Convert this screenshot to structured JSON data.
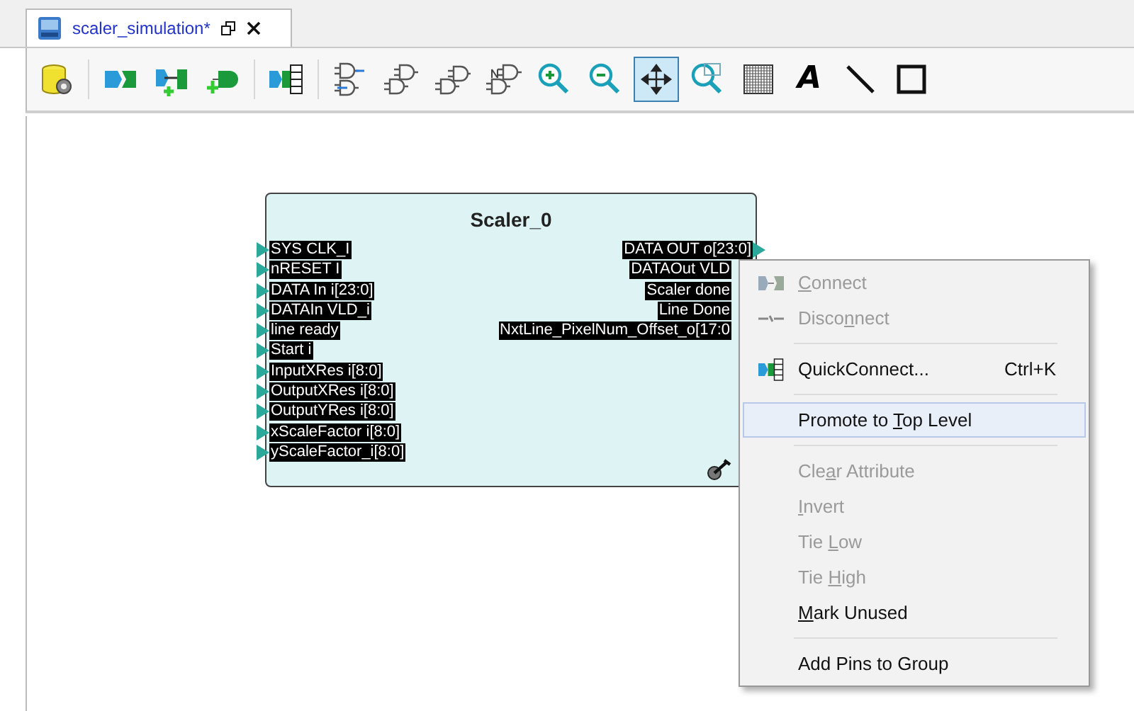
{
  "tab": {
    "title": "scaler_simulation*",
    "selected": true
  },
  "toolbar": [
    {
      "kind": "db-gear",
      "pressed": false
    },
    {
      "kind": "separator"
    },
    {
      "kind": "connect",
      "pressed": false
    },
    {
      "kind": "add-port",
      "pressed": false
    },
    {
      "kind": "add-pin",
      "pressed": false
    },
    {
      "kind": "separator"
    },
    {
      "kind": "quickconnect",
      "pressed": false
    },
    {
      "kind": "separator"
    },
    {
      "kind": "gates-swap",
      "pressed": false
    },
    {
      "kind": "gate-a",
      "pressed": false
    },
    {
      "kind": "gate-b",
      "pressed": false
    },
    {
      "kind": "gate-c",
      "pressed": false
    },
    {
      "kind": "zoom-in",
      "pressed": false
    },
    {
      "kind": "zoom-out",
      "pressed": false
    },
    {
      "kind": "fit",
      "pressed": true
    },
    {
      "kind": "zoom-area",
      "pressed": false
    },
    {
      "kind": "grid",
      "pressed": false
    },
    {
      "kind": "text",
      "label": "A",
      "pressed": false
    },
    {
      "kind": "line",
      "pressed": false
    },
    {
      "kind": "rect",
      "pressed": false
    }
  ],
  "block": {
    "title": "Scaler_0",
    "inputs": [
      "SYS CLK_I",
      "nRESET I",
      "DATA In i[23:0]",
      "DATAIn VLD_i",
      "line ready",
      "Start i",
      "InputXRes i[8:0]",
      "OutputXRes i[8:0]",
      "OutputYRes i[8:0]",
      "xScaleFactor i[8:0]",
      "yScaleFactor_i[8:0]"
    ],
    "outputs": [
      {
        "label": "DATA OUT o[23:0]",
        "pin": true
      },
      {
        "label": "DATAOut VLD",
        "pin": false
      },
      {
        "label": "Scaler done",
        "pin": false
      },
      {
        "label": "Line Done",
        "pin": false
      },
      {
        "label": "NxtLine_PixelNum_Offset_o[17:0",
        "pin": false
      }
    ]
  },
  "context_menu": [
    {
      "kind": "connect",
      "label_key": "C",
      "label_after": "onnect",
      "disabled": true,
      "selected": false
    },
    {
      "kind": "disconnect",
      "label_before": "Disco",
      "label_key": "n",
      "label_after": "nect",
      "disabled": true,
      "selected": false
    },
    {
      "kind": "separator"
    },
    {
      "kind": "quickconnect",
      "label_before": "QuickConnect...",
      "shortcut": "Ctrl+K",
      "disabled": false,
      "selected": false
    },
    {
      "kind": "separator"
    },
    {
      "kind": "item",
      "label_before": "Promote to ",
      "label_key": "T",
      "label_after": "op Level",
      "disabled": false,
      "selected": true
    },
    {
      "kind": "separator"
    },
    {
      "kind": "item",
      "label_before": "Cle",
      "label_key": "a",
      "label_after": "r Attribute",
      "disabled": true,
      "selected": false
    },
    {
      "kind": "item",
      "label_key": "I",
      "label_after": "nvert",
      "disabled": true,
      "selected": false
    },
    {
      "kind": "item",
      "label_before": "Tie ",
      "label_key": "L",
      "label_after": "ow",
      "disabled": true,
      "selected": false
    },
    {
      "kind": "item",
      "label_before": "Tie ",
      "label_key": "H",
      "label_after": "igh",
      "disabled": true,
      "selected": false
    },
    {
      "kind": "item",
      "label_key": "M",
      "label_after": "ark Unused",
      "disabled": false,
      "selected": false
    },
    {
      "kind": "separator"
    },
    {
      "kind": "item",
      "label_before": "Add Pins to Group",
      "disabled": false,
      "selected": false
    }
  ]
}
